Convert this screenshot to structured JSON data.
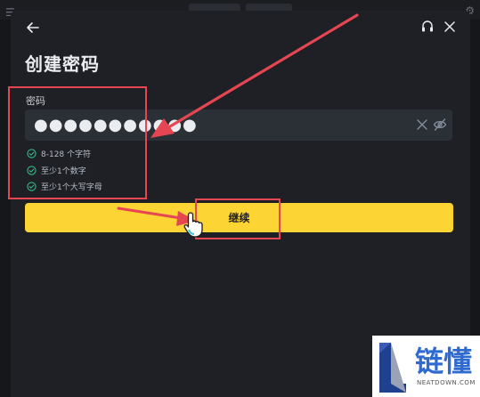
{
  "dialog": {
    "title": "创建密码",
    "password_label": "密码",
    "password_value": "●●●●●●●●●●●",
    "rules": [
      {
        "text": "8-128 个字符",
        "satisfied": true
      },
      {
        "text": "至少1个数字",
        "satisfied": true
      },
      {
        "text": "至少1个大写字母",
        "satisfied": true
      }
    ],
    "continue_label": "继续"
  },
  "icons": {
    "back": "arrow-left-icon",
    "support": "headset-icon",
    "close": "close-icon",
    "clear": "clear-icon",
    "visibility": "eye-off-icon",
    "rule_check": "check-circle-icon"
  },
  "colors": {
    "modal_bg": "#1e2026",
    "input_bg": "#2b2f36",
    "accent_yellow": "#fcd535",
    "check_green": "#2ebd85",
    "annotation_red": "#e64552"
  },
  "watermark": {
    "brand": "链懂",
    "url": "NEATDOWN.COM"
  }
}
